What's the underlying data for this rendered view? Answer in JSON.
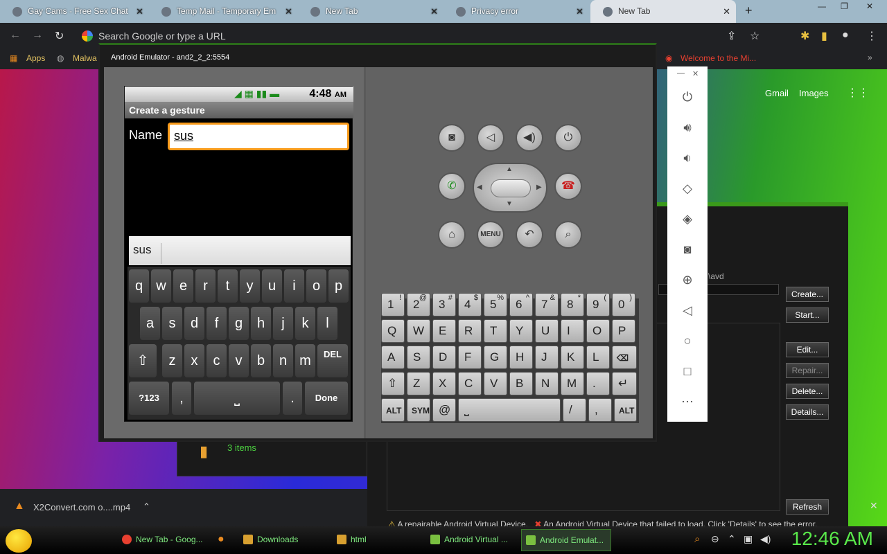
{
  "browser": {
    "tabs": [
      {
        "label": "Gay Cams - Free Sex Chat"
      },
      {
        "label": "Temp Mail - Temporary Em"
      },
      {
        "label": "New Tab"
      },
      {
        "label": "Privacy error"
      },
      {
        "label": "New Tab"
      }
    ],
    "omnibox_placeholder": "Search Google or type a URL",
    "bookmarks": [
      "Apps",
      "Malwa",
      "Welcome to the Mi..."
    ],
    "google_links": [
      "Gmail",
      "Images"
    ]
  },
  "emulator": {
    "title": "Android Emulator - and2_2_2:5554",
    "phone": {
      "time": "4:48",
      "ampm": "AM",
      "screen_title": "Create a gesture",
      "name_label": "Name",
      "name_value": "sus",
      "suggestion": "sus",
      "keys_row1": [
        "q",
        "w",
        "e",
        "r",
        "t",
        "y",
        "u",
        "i",
        "o",
        "p"
      ],
      "keys_row2": [
        "a",
        "s",
        "d",
        "f",
        "g",
        "h",
        "j",
        "k",
        "l"
      ],
      "keys_row3": [
        "z",
        "x",
        "c",
        "v",
        "b",
        "n",
        "m"
      ],
      "del_label": "DEL",
      "sym_label": "?123",
      "comma": ",",
      "period": ".",
      "done_label": "Done"
    },
    "controls": {
      "menu_label": "MENU"
    },
    "qwerty": {
      "row1": [
        "1",
        "2",
        "3",
        "4",
        "5",
        "6",
        "7",
        "8",
        "9",
        "0"
      ],
      "row1_sub": [
        "!",
        "@",
        "#",
        "$",
        "%",
        "^",
        "&",
        "*",
        "(",
        ")"
      ],
      "row2": [
        "Q",
        "W",
        "E",
        "R",
        "T",
        "Y",
        "U",
        "I",
        "O",
        "P"
      ],
      "row3": [
        "A",
        "S",
        "D",
        "F",
        "G",
        "H",
        "J",
        "K",
        "L"
      ],
      "row4": [
        "Z",
        "X",
        "C",
        "V",
        "B",
        "N",
        "M",
        "."
      ],
      "alt": "ALT",
      "sym": "SYM",
      "at": "@",
      "slash": "/",
      "comma": ","
    }
  },
  "avd_manager": {
    "path_hint": "\\avd",
    "buttons": [
      "Create...",
      "Start...",
      "Edit...",
      "Repair...",
      "Delete...",
      "Details...",
      "Refresh"
    ],
    "legend_repairable": "A repairable Android Virtual Device.",
    "legend_failed": "An Android Virtual Device that failed to load. Click 'Details' to see the error."
  },
  "explorer": {
    "items": "3 items"
  },
  "downloads": {
    "file": "X2Convert.com o....mp4"
  },
  "taskbar": {
    "items": [
      "New Tab - Goog...",
      "Downloads",
      "html",
      "Android Virtual ...",
      "Android Emulat..."
    ],
    "clock": "12:46 AM"
  }
}
